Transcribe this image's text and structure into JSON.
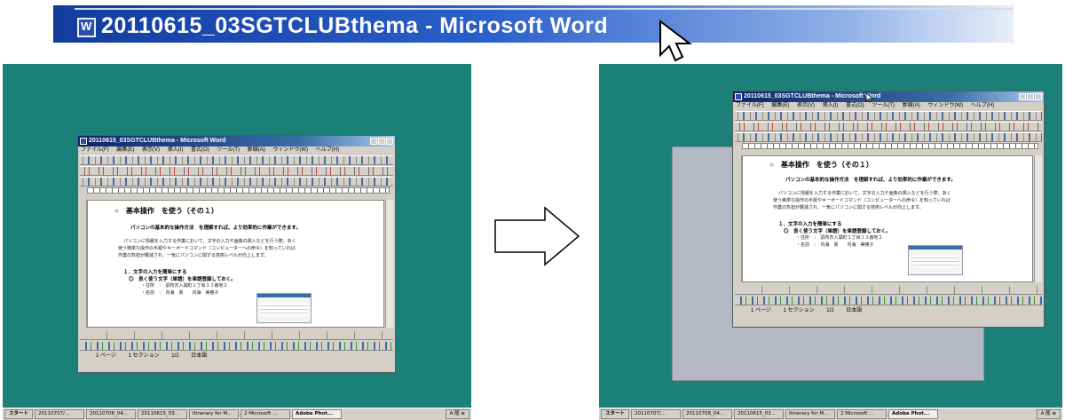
{
  "zoomed_title": "20110615_03SGTCLUBthema - Microsoft Word",
  "colors": {
    "desktop": "#1a8078",
    "title_dark": "#123c9c",
    "title_light": "#e8eef8",
    "window_face": "#d4d0c8"
  },
  "window": {
    "title": "20110615_03SGTCLUBthema - Microsoft Word",
    "menu": [
      "ファイル(F)",
      "編集(E)",
      "表示(V)",
      "挿入(I)",
      "書式(O)",
      "ツール(T)",
      "罫線(A)",
      "ウィンドウ(W)",
      "ヘルプ(H)"
    ],
    "style_box": "標準 Swiss",
    "font_box": "MS 明朝",
    "size_box": "14",
    "zoom": "70%",
    "review_box": "最終版 (変更箇所/コメントの表示)"
  },
  "document": {
    "heading": "○　基本操作　を使う（その１）",
    "subtitle": "パソコンの基本的な操作方法　を理解すれば、より効率的に作業ができます。",
    "paragraph": [
      "パソコンに情報を入力する作業において、文字の入力や画像の挿入などを行う際、あく",
      "使う簡単な操作の手順やキーボードコマンド（コンピューターへの命令）を知っていれば",
      "作業の負担が軽減され、一気にパソコンに関する技術レベルが向上します。"
    ],
    "section": "１．文字の入力を簡単にする",
    "item": "◎　良く使う文字（単語）を単語登録しておく。",
    "address": "・住所　：　調布市入間町１丁目３３番地２",
    "name": "・名前　：　内海　眞　　内海　美穂子"
  },
  "bottom_tasks": [
    "[1]MSフィールド",
    "[2]元のサイズ",
    "[3]MSウィンドウ",
    "[4]MSパス ミス",
    "マクロ...",
    "[6]フィールド コー...",
    "[7]最大化"
  ],
  "status_bar": [
    "1 ページ",
    "1 セクション",
    "1/2",
    "日本語"
  ],
  "taskbar": {
    "start": "スタート",
    "tasks": [
      "20110707/...",
      "20110708_04...",
      "20110615_03...",
      "Itinerary for M...",
      "2 Microsoft ...",
      "Adobe Phot..."
    ],
    "tray": "A 般 ≡"
  }
}
